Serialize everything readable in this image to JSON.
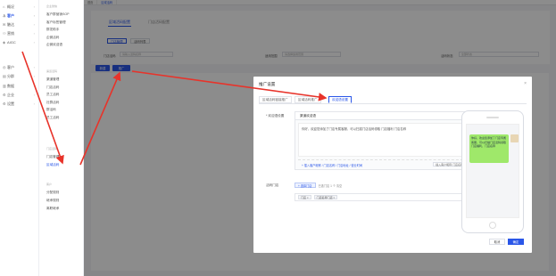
{
  "sidebar": {
    "items": [
      {
        "icon": "⌂",
        "label": "概况",
        "active": false
      },
      {
        "icon": "♙",
        "label": "客户",
        "active": true
      },
      {
        "icon": "✉",
        "label": "触达",
        "active": false
      },
      {
        "icon": "⚇",
        "label": "营销",
        "active": false
      },
      {
        "icon": "◈",
        "label": "AIGC",
        "active": false
      },
      {
        "icon": "◎",
        "label": "客户",
        "active": false
      },
      {
        "icon": "▤",
        "label": "分群",
        "active": false
      },
      {
        "icon": "▥",
        "label": "数据",
        "active": false
      },
      {
        "icon": "⚙",
        "label": "企业",
        "active": false
      },
      {
        "icon": "⚙",
        "label": "设置",
        "active": false
      }
    ]
  },
  "submenu": {
    "group1": "企业微信",
    "g1_items": [
      "客户群营销SOP",
      "客户标签管理",
      "群发助手",
      "企微活码",
      "企微欢迎语"
    ],
    "group2": "渠道活码",
    "g2_items": [
      "渠道管理",
      "门店活码",
      "员工活码",
      "社群活码",
      "群活码",
      "员工活码"
    ],
    "group3": "门店活码",
    "g3_items": [
      "门店管理",
      "区域活码"
    ],
    "group4": "客户",
    "g4_items": [
      "分配规则",
      "继承规则",
      "离职继承"
    ]
  },
  "topbar": {
    "tabs": [
      "首页",
      "区域活码"
    ]
  },
  "main": {
    "tab1": "区域活码配置",
    "tab2": "门店活码配置",
    "sub_btn1": "门店管理",
    "sub_btn2": "活码列表",
    "filter1_label": "门店活码",
    "filter1_placeholder": "请输入活码名称",
    "filter2_label": "适用范围",
    "filter2_placeholder": "请选择适用范围",
    "filter3_label": "活码状态",
    "filter3_placeholder": "全部状态",
    "create_btn": "新建",
    "promote_btn": "推广"
  },
  "modal": {
    "title": "推广设置",
    "tabs": [
      "区域活码链接推广",
      "区域活码推广",
      "欢迎语设置"
    ],
    "welcome_label": "* 欢迎语设置",
    "msg_tab": "渠道欢迎语",
    "msg_text": "你好，欢迎您添加了门店专属客服，可以扫描门店活码领取 门店福利 门店名称",
    "msg_insert": "+ 插入客户昵称 / 门店名称 / 门店地址 / 营业时间",
    "msg_insert_btn": "插入客户昵称 门店名称",
    "qr_label": "活码门店",
    "qr_btn": "+ 选择门店",
    "qr_hint": "已选门店 1 个 清空",
    "qr_tags": [
      "门店 ×",
      "门店名称门店 ×"
    ],
    "preview_text": "你好，欢迎您添加了门店专属客服，可以扫描门店活码领取门店福利，门店名称",
    "cancel_btn": "取消",
    "confirm_btn": "确定"
  },
  "colors": {
    "accent": "#2a56e8",
    "arrow": "#e8332a",
    "bubble": "#9fe86a"
  }
}
